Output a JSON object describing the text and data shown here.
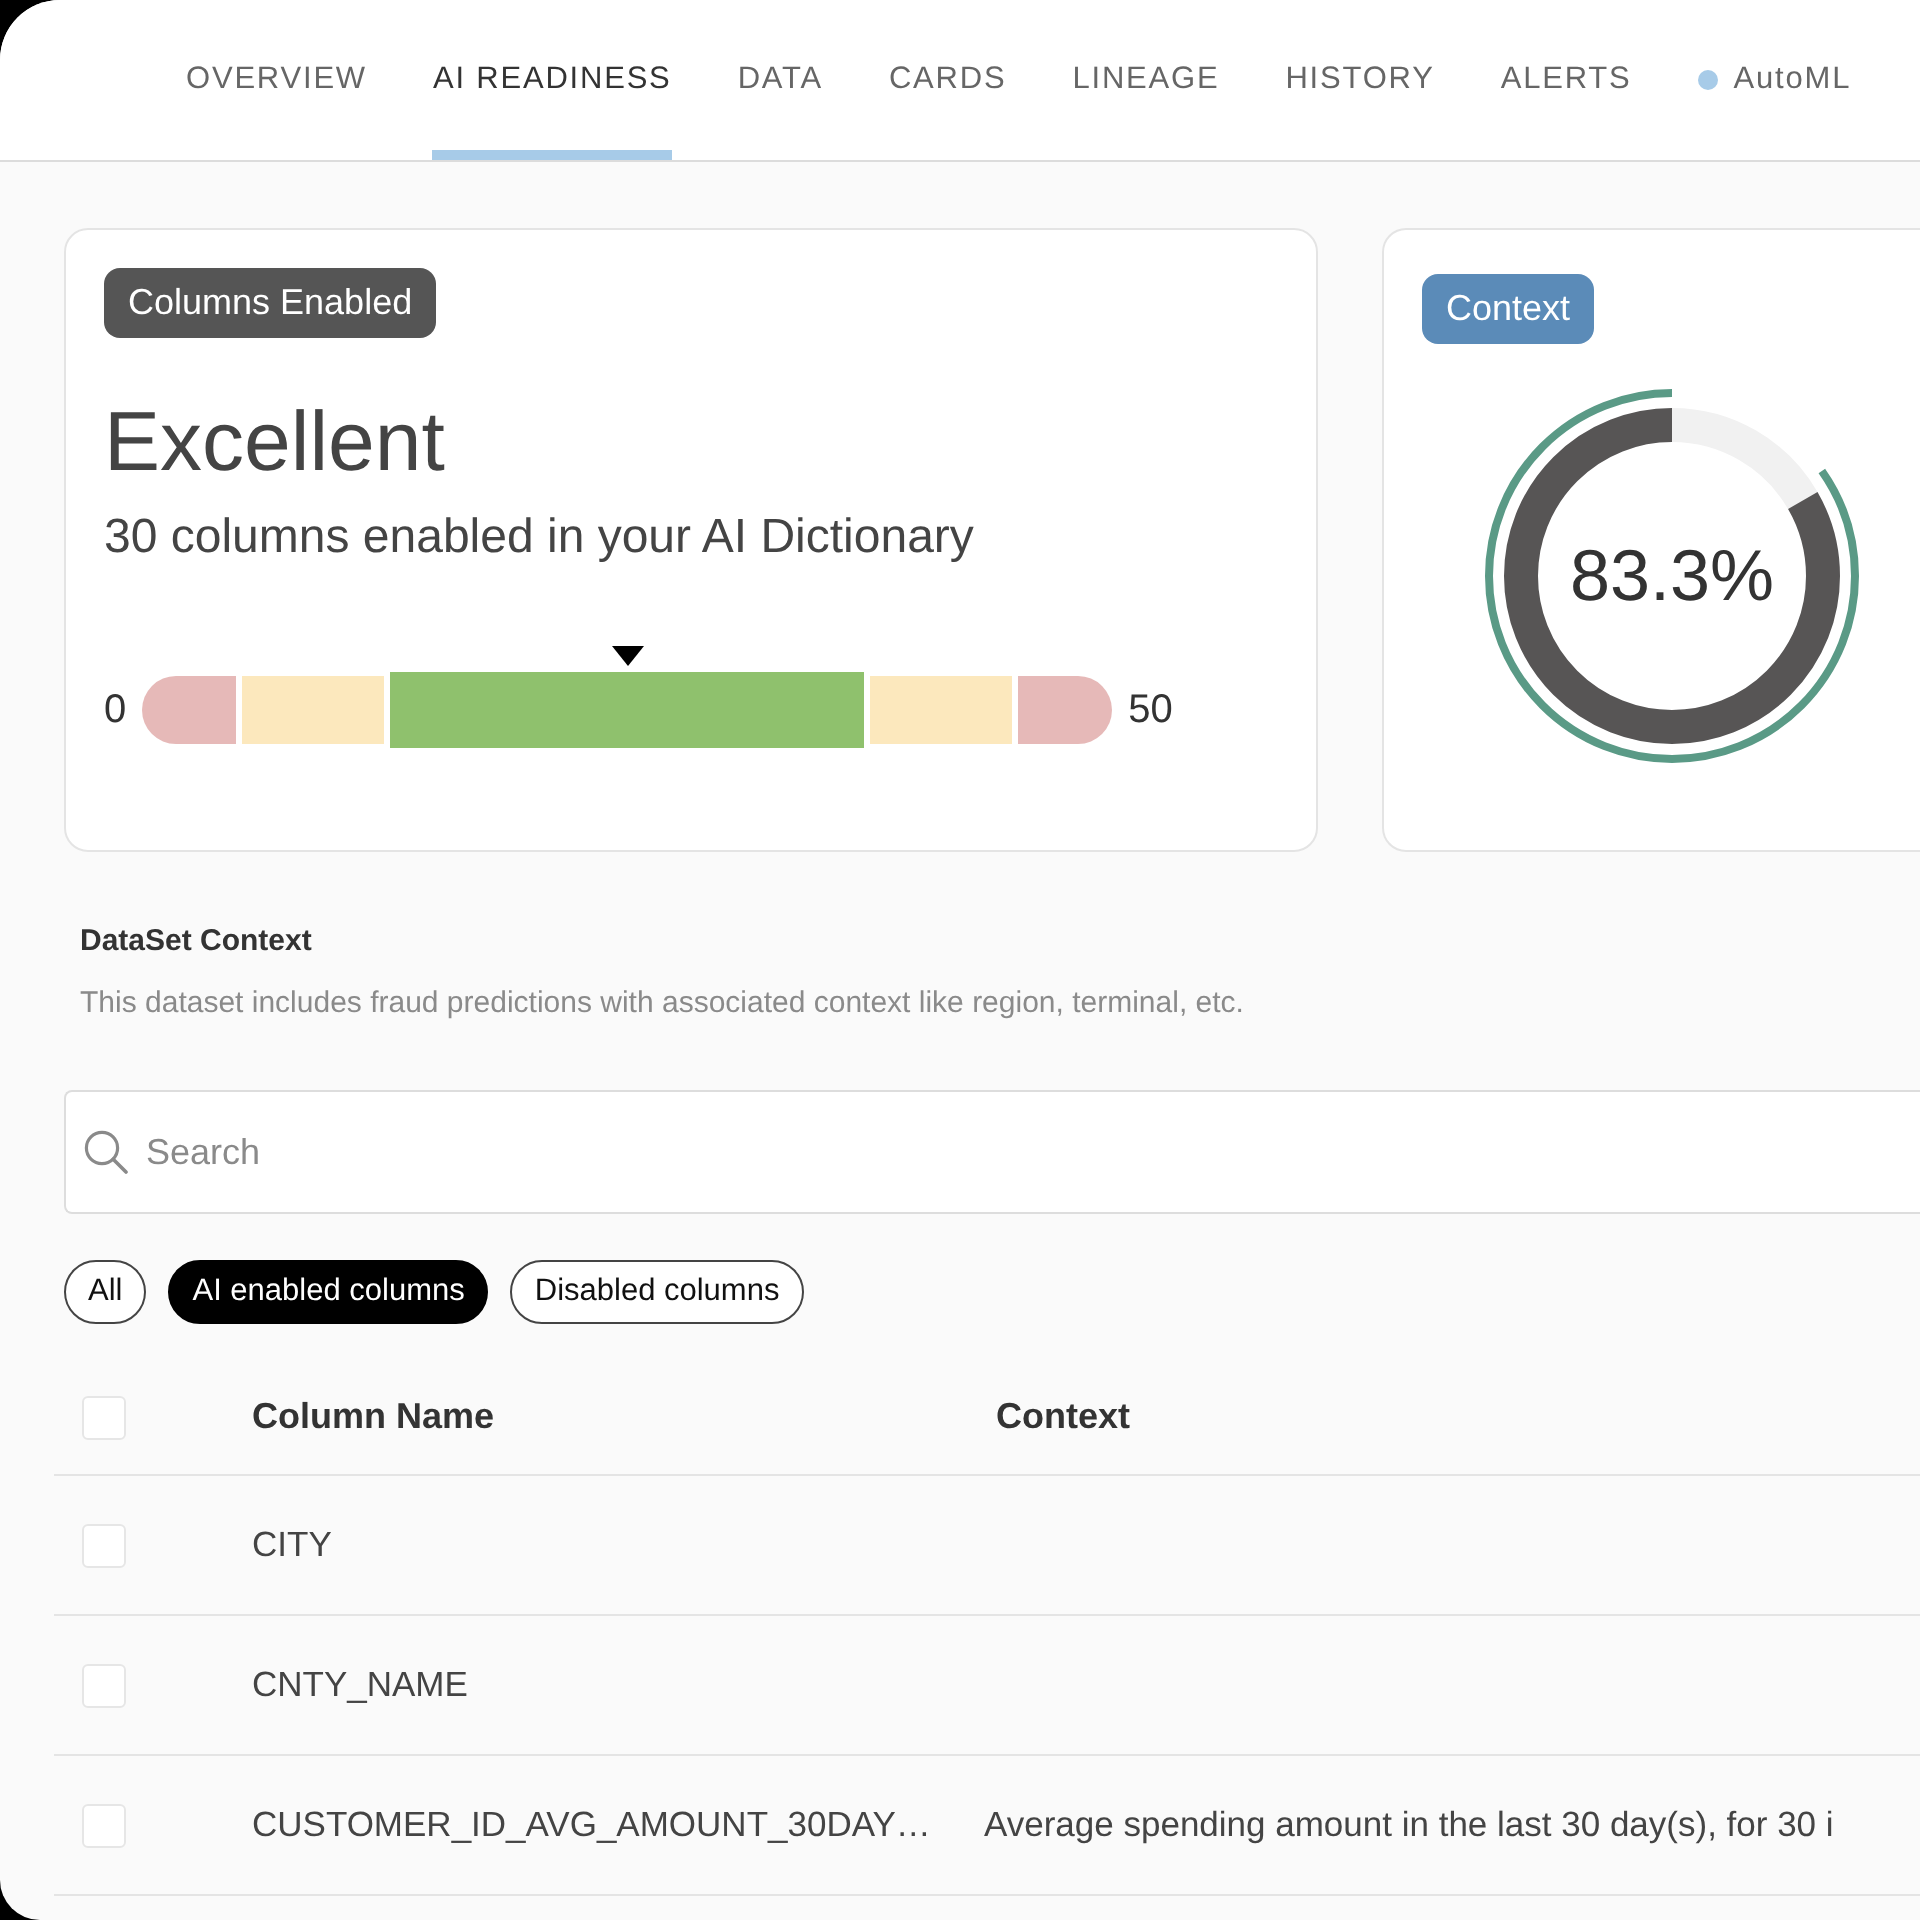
{
  "tabs": [
    {
      "kind": "text",
      "label": "OVERVIEW",
      "selected": false
    },
    {
      "kind": "text",
      "label": "AI READINESS",
      "selected": true
    },
    {
      "kind": "text",
      "label": "DATA",
      "selected": false
    },
    {
      "kind": "text",
      "label": "CARDS",
      "selected": false
    },
    {
      "kind": "text",
      "label": "LINEAGE",
      "selected": false
    },
    {
      "kind": "text",
      "label": "HISTORY",
      "selected": false
    },
    {
      "kind": "text",
      "label": "ALERTS",
      "selected": false
    },
    {
      "kind": "dot",
      "label": "AutoML",
      "selected": false
    }
  ],
  "readiness_card": {
    "tag": "Columns Enabled",
    "rating": "Excellent",
    "summary": "30 columns enabled in your AI Dictionary",
    "gauge": {
      "min_label": "0",
      "max_label": "50",
      "level": 0.5,
      "segments": [
        {
          "color": "#e6b9b8",
          "selected": false
        },
        {
          "color": "#fce8bd",
          "selected": false
        },
        {
          "color": "#8fc16d",
          "selected": true
        },
        {
          "color": "#fce8bd",
          "selected": false
        },
        {
          "color": "#e6b9b8",
          "selected": false
        }
      ]
    }
  },
  "context_card": {
    "tag": "Context",
    "ring": {
      "level": 0.833,
      "reading": "83.3%"
    }
  },
  "dataset_context": {
    "title": "DataSet Context",
    "description": "This dataset includes fraud predictions with associated context like region, terminal, etc."
  },
  "search": {
    "placeholder": "Search"
  },
  "filters": [
    {
      "label": "All",
      "selected": false
    },
    {
      "label": "AI enabled columns",
      "selected": true
    },
    {
      "label": "Disabled columns",
      "selected": false
    }
  ],
  "table": {
    "select_all_checked": false,
    "columns": [
      "Column Name",
      "Context"
    ],
    "rows": [
      {
        "checked": false,
        "column_name": "CITY"
      },
      {
        "checked": false,
        "column_name": "CNTY_NAME"
      },
      {
        "checked": false,
        "column_name": "CUSTOMER_ID_AVG_AMOUNT_30DAY…",
        "context": "Average spending amount in the last 30 day(s), for 30 i"
      }
    ]
  }
}
